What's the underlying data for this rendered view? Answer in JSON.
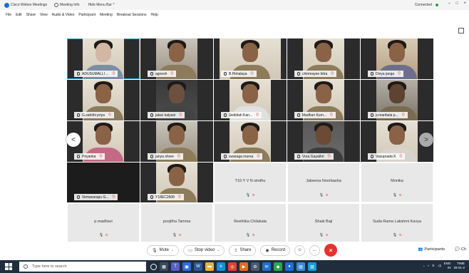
{
  "titlebar": {
    "app_name": "Cisco Webex Meetings",
    "meeting_info": "Meeting Info",
    "hide_menu_bar": "Hide Menu Bar ^",
    "connection_status": "Connected",
    "status_color": "#2ea043"
  },
  "menu": {
    "items": [
      "File",
      "Edit",
      "Share",
      "View",
      "Audio & Video",
      "Participant",
      "Meeting",
      "Breakout Sessions",
      "Help"
    ]
  },
  "grid": {
    "video_participants": [
      "ADUSUMALLI ...",
      "agnesh",
      "B.Himalaya",
      "chinmayee bitra",
      "Divya janga",
      "G.sahithi priya",
      "jalaci kalyani",
      "Jedidiah Kan...",
      "Madhuri Kum...",
      "p.maribala p...",
      "Priyanka",
      "janya shree",
      "swaraga murea",
      "Vora Gayathri",
      "Vasuprada K",
      "Vemavarapu G...",
      "Y18EC2608"
    ],
    "audio_only_participants": [
      "T10.Y V N sindhu",
      "Jabeena Noorbasha",
      "Monika",
      "p.madhavi",
      "poojitha Tamma",
      "Reethika Chilakala",
      "Shaik Baji",
      "Suda Rama Lakshmi Kavya"
    ],
    "mic_icon": "microphone-icon",
    "mute_icon": "muted-icon",
    "prev_page": "<",
    "next_page": ">",
    "active_speaker_color": "#22aee6"
  },
  "controls": {
    "mute": "Mute",
    "stop_video": "Stop video",
    "share": "Share",
    "record": "Record",
    "more": "...",
    "end": "×",
    "end_color": "#e5322d"
  },
  "panel": {
    "participants": "Participants",
    "chat": "Ch"
  },
  "taskbar": {
    "search_placeholder": "Type here to search",
    "lang": "ENG",
    "region": "IN",
    "time": "TIME",
    "date": "28-01-2"
  }
}
